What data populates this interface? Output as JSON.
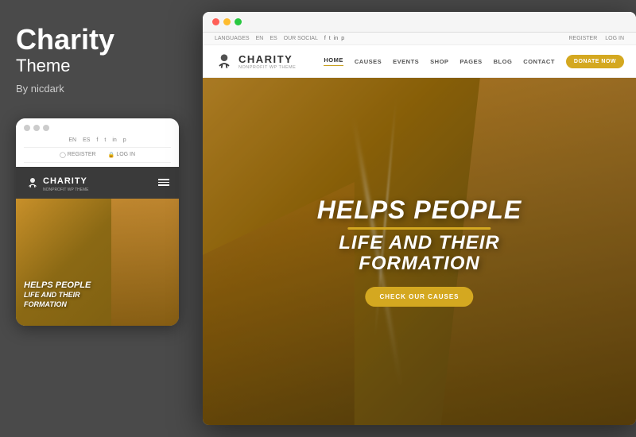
{
  "left": {
    "title": "Charity",
    "subtitle": "Theme",
    "author": "By nicdark"
  },
  "mobile": {
    "dots": [
      "dot1",
      "dot2",
      "dot3"
    ],
    "social_items": [
      "EN",
      "ES",
      "f",
      "t",
      "in",
      "p"
    ],
    "register_label": "REGISTER",
    "login_label": "LOG IN",
    "logo_text": "CHARITY",
    "logo_tagline": "NONPROFIT WP THEME",
    "hero_line1": "HELPS PEOPLE",
    "hero_line2": "LIFE AND THEIR",
    "hero_line3": "FORMATION"
  },
  "desktop": {
    "top_bar": {
      "languages": "LANGUAGES",
      "lang1": "EN",
      "lang2": "ES",
      "our_social": "OUR SOCIAL",
      "social_items": [
        "f",
        "t",
        "in",
        "p"
      ],
      "register": "REGISTER",
      "login": "LOG IN"
    },
    "nav": {
      "logo_text": "CHARITY",
      "logo_tagline": "NONPROFIT WP THEME",
      "links": [
        "HOME",
        "CAUSES",
        "EVENTS",
        "SHOP",
        "PAGES",
        "BLOG",
        "CONTACT"
      ],
      "active_link": "HOME",
      "donate_label": "DONATE NOW"
    },
    "hero": {
      "line1": "HELPS PEOPLE",
      "line2": "LIFE AND THEIR",
      "line3": "FORMATION",
      "cta_label": "CHECK OUR CAUSES"
    }
  }
}
